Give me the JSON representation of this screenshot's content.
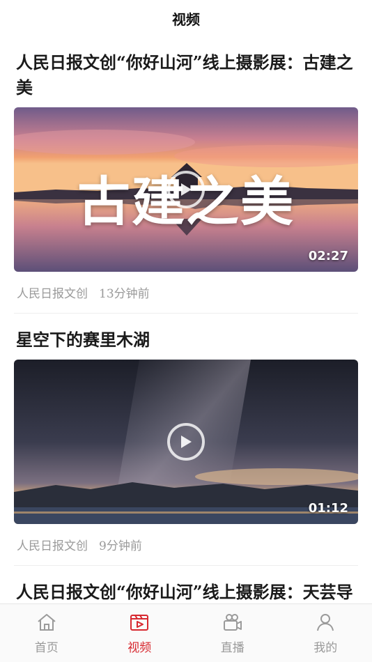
{
  "header": {
    "title": "视频"
  },
  "videos": [
    {
      "title": "人民日报文创“你好山河”线上摄影展：古建之美",
      "overlay": "古建之美",
      "duration": "02:27",
      "source": "人民日报文创",
      "time": "13分钟前"
    },
    {
      "title": "星空下的赛里木湖",
      "duration": "01:12",
      "source": "人民日报文创",
      "time": "9分钟前"
    },
    {
      "title": "人民日报文创“你好山河”线上摄影展：天芸导广"
    }
  ],
  "tabbar": {
    "items": [
      {
        "label": "首页",
        "icon": "home-icon"
      },
      {
        "label": "视频",
        "icon": "video-icon"
      },
      {
        "label": "直播",
        "icon": "camera-icon"
      },
      {
        "label": "我的",
        "icon": "user-icon"
      }
    ],
    "active_index": 1
  },
  "colors": {
    "accent": "#d7282f",
    "inactive": "#9a9a9a"
  }
}
